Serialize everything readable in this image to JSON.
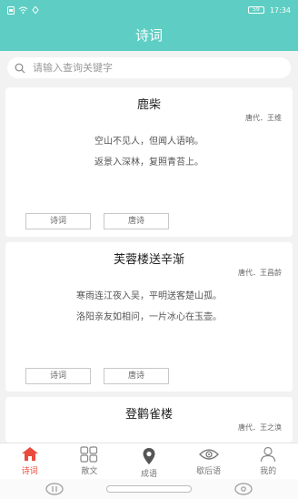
{
  "status": {
    "time": "17:34",
    "battery": "59"
  },
  "header": {
    "title": "诗词"
  },
  "search": {
    "placeholder": "请输入查询关键字"
  },
  "poems": [
    {
      "title": "鹿柴",
      "author": "唐代．王维",
      "lines": [
        "空山不见人，但闻人语响。",
        "返景入深林，复照青苔上。"
      ],
      "tags": [
        "诗词",
        "唐诗"
      ]
    },
    {
      "title": "芙蓉楼送辛渐",
      "author": "唐代．王昌龄",
      "lines": [
        "寒雨连江夜入吴，平明送客楚山孤。",
        "洛阳亲友如相问，一片冰心在玉壶。"
      ],
      "tags": [
        "诗词",
        "唐诗"
      ]
    },
    {
      "title": "登鹳雀楼",
      "author": "唐代．王之涣"
    }
  ],
  "nav": [
    {
      "label": "诗词",
      "icon": "home-icon"
    },
    {
      "label": "散文",
      "icon": "grid-icon"
    },
    {
      "label": "成语",
      "icon": "location-pin-icon"
    },
    {
      "label": "歇后语",
      "icon": "eye-icon"
    },
    {
      "label": "我的",
      "icon": "user-icon"
    }
  ],
  "colors": {
    "primary": "#5ecec4",
    "active": "#e94b3c"
  }
}
